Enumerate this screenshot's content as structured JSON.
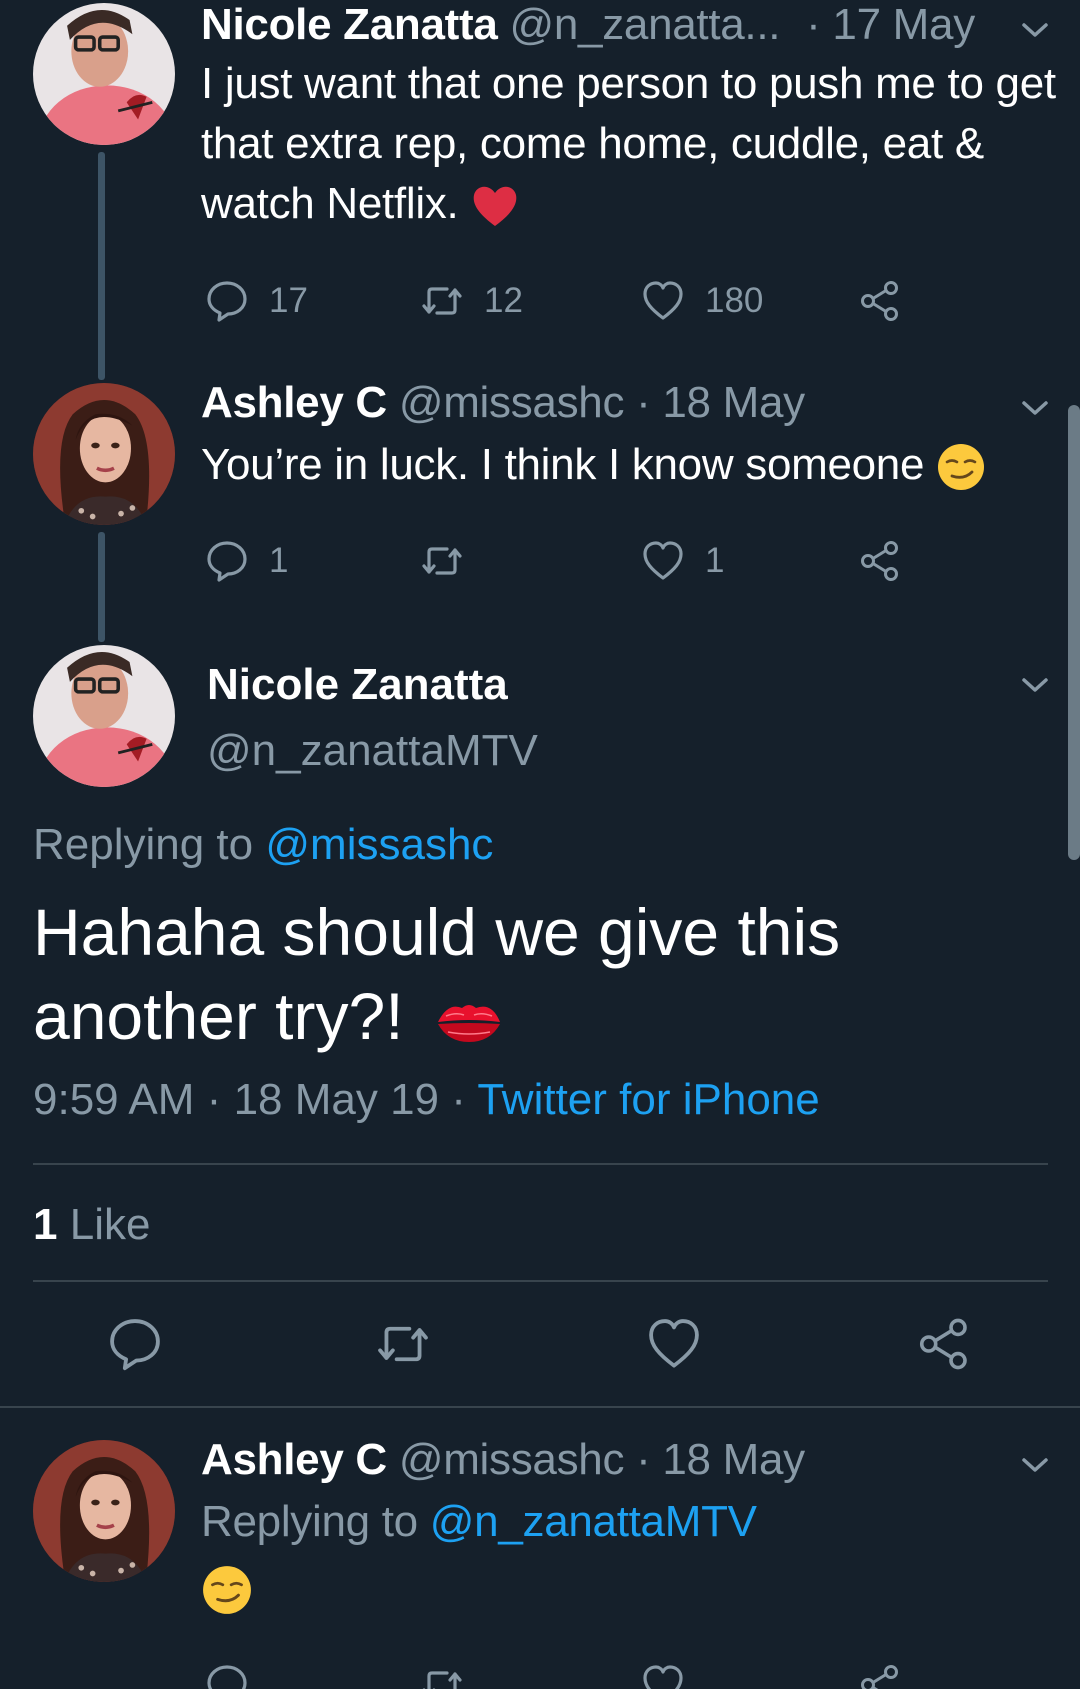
{
  "tweet1": {
    "name": "Nicole Zanatta",
    "handle": "@n_zanatta...",
    "date": "· 17 May",
    "text": "I just want that one person to push me to get that extra rep, come home, cuddle, eat & watch Netflix.",
    "emoji": "heart",
    "replies": "17",
    "retweets": "12",
    "likes": "180"
  },
  "tweet2": {
    "name": "Ashley C",
    "handle": "@missashc",
    "date": "· 18 May",
    "text": "You’re in luck. I think I know someone",
    "emoji": "smirking-face",
    "replies": "1",
    "retweets": "",
    "likes": "1"
  },
  "main_tweet": {
    "name": "Nicole Zanatta",
    "handle": "@n_zanattaMTV",
    "replying_prefix": "Replying to",
    "replying_to": "@missashc",
    "text": "Hahaha should we give this another try?!",
    "emoji": "kiss-mark",
    "time": "9:59 AM",
    "separator": "·",
    "date": "18 May 19",
    "source": "Twitter for iPhone",
    "likes_count": "1",
    "likes_label": "Like"
  },
  "tweet3": {
    "name": "Ashley C",
    "handle": "@missashc",
    "date": "· 18 May",
    "replying_prefix": "Replying to",
    "replying_to": "@n_zanattaMTV",
    "emoji": "smirking-face"
  },
  "colors": {
    "background": "#15202b",
    "text": "#ffffff",
    "secondary": "#8899a6",
    "link": "#1da1f2",
    "divider": "#38444d",
    "heart_emoji": "#e0245e"
  }
}
